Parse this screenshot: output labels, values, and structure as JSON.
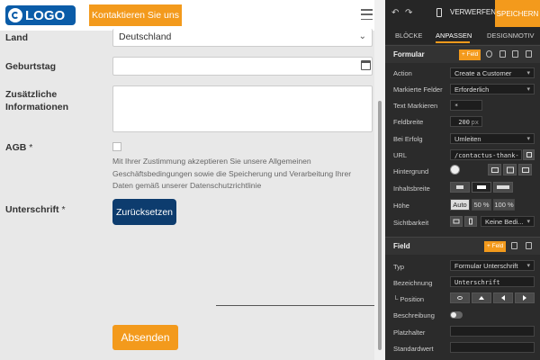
{
  "preview": {
    "logo_text": "LOGO",
    "contact_button": "Kontaktieren Sie uns",
    "fields": {
      "land_label": "Land",
      "land_value": "Deutschland",
      "birthday_label": "Geburtstag",
      "info_label_line1": "Zusätzliche",
      "info_label_line2": "Informationen",
      "agb_label": "AGB",
      "agb_required": "*",
      "agb_text": "Mit Ihrer Zustimmung akzeptieren Sie unsere Allgemeinen Geschäftsbedingungen sowie die Speicherung und Verarbeitung Ihrer Daten gemäß unserer Datenschutzrichtlinie",
      "signature_label": "Unterschrift",
      "signature_required": "*",
      "reset_button": "Zurücksetzen",
      "submit_button": "Absenden"
    }
  },
  "toolbar": {
    "discard_label": "VERWERFEN",
    "save_label": "SPEICHERN"
  },
  "tabs": [
    {
      "label": "BLÖCKE",
      "active": false
    },
    {
      "label": "ANPASSEN",
      "active": true
    },
    {
      "label": "DESIGNMOTIV",
      "active": false
    }
  ],
  "formular": {
    "title": "Formular",
    "add_field": "+ Feld",
    "rows": {
      "action_label": "Action",
      "action_value": "Create a Customer",
      "marked_label": "Markierte Felder",
      "marked_value": "Erforderlich",
      "text_marked_label": "Text Markieren",
      "text_marked_value": "*",
      "width_label": "Feldbreite",
      "width_value": "200",
      "width_unit": "px",
      "success_label": "Bei Erfolg",
      "success_value": "Umleiten",
      "url_label": "URL",
      "url_value": "/contactus-thank-",
      "background_label": "Hintergrund",
      "content_width_label": "Inhaltsbreite",
      "height_label": "Höhe",
      "height_options": [
        "Auto",
        "50 %",
        "100 %"
      ],
      "visibility_label": "Sichtbarkeit",
      "visibility_value": "Keine Bedi..."
    }
  },
  "field_section": {
    "title": "Field",
    "add_field": "+ Feld",
    "rows": {
      "type_label": "Typ",
      "type_value": "Formular Unterschrift",
      "name_label": "Bezeichnung",
      "name_value": "Unterschrift",
      "position_label": "└ Position",
      "description_label": "Beschreibung",
      "placeholder_label": "Platzhalter",
      "default_label": "Standardwert"
    }
  },
  "colors": {
    "accent": "#f39a1c",
    "brand": "#0a5ca8",
    "reset_button": "#0d3c6e",
    "panel_bg": "#2b2b2b"
  }
}
